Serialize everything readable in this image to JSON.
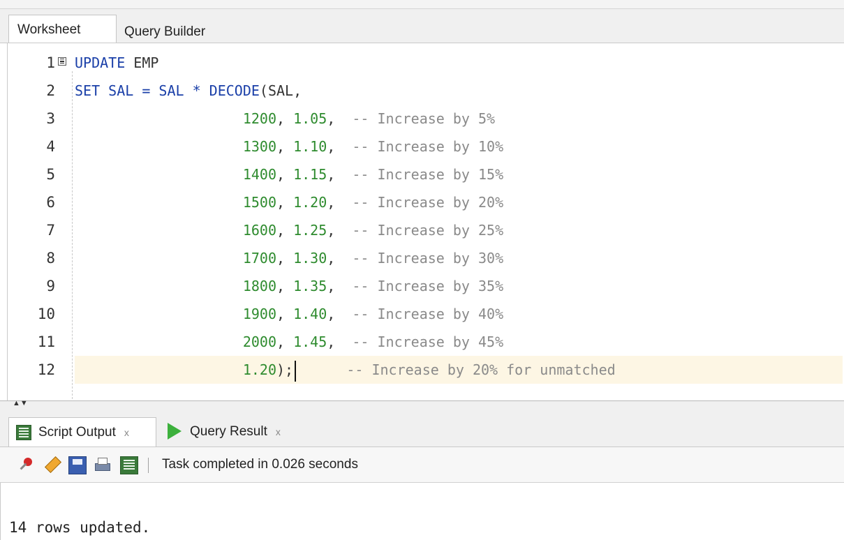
{
  "tabs": {
    "worksheet": "Worksheet",
    "query_builder": "Query Builder"
  },
  "editor": {
    "lines": [
      {
        "n": "1",
        "kw": "UPDATE",
        "rest": " EMP"
      },
      {
        "n": "2",
        "a": "SET SAL = SAL * ",
        "kw": "DECODE",
        "b": "(SAL,"
      },
      {
        "n": "3",
        "v1": "1200",
        "v2": "1.05",
        "comment": "-- Increase by 5%"
      },
      {
        "n": "4",
        "v1": "1300",
        "v2": "1.10",
        "comment": "-- Increase by 10%"
      },
      {
        "n": "5",
        "v1": "1400",
        "v2": "1.15",
        "comment": "-- Increase by 15%"
      },
      {
        "n": "6",
        "v1": "1500",
        "v2": "1.20",
        "comment": "-- Increase by 20%"
      },
      {
        "n": "7",
        "v1": "1600",
        "v2": "1.25",
        "comment": "-- Increase by 25%"
      },
      {
        "n": "8",
        "v1": "1700",
        "v2": "1.30",
        "comment": "-- Increase by 30%"
      },
      {
        "n": "9",
        "v1": "1800",
        "v2": "1.35",
        "comment": "-- Increase by 35%"
      },
      {
        "n": "10",
        "v1": "1900",
        "v2": "1.40",
        "comment": "-- Increase by 40%"
      },
      {
        "n": "11",
        "v1": "2000",
        "v2": "1.45",
        "comment": "-- Increase by 45%"
      },
      {
        "n": "12",
        "v2": "1.20",
        "end": ");",
        "comment": "-- Increase by 20% for unmatched"
      }
    ]
  },
  "output_tabs": {
    "script_output": "Script Output",
    "query_result": "Query Result",
    "close": "x"
  },
  "toolbar": {
    "status": "Task completed in 0.026 seconds"
  },
  "output": {
    "text": "14 rows updated."
  },
  "icons": [
    "pin-icon",
    "eraser-icon",
    "save-icon",
    "print-icon",
    "document-icon",
    "script-icon",
    "play-icon",
    "fold-icon"
  ]
}
